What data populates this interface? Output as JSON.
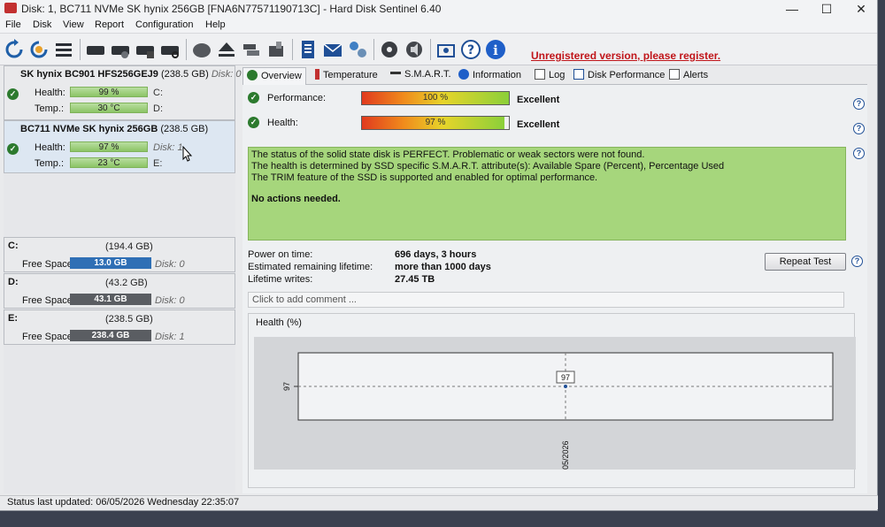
{
  "window": {
    "title": "Disk: 1, BC711 NVMe SK hynix 256GB [FNA6N77571190713C]  -  Hard Disk Sentinel 6.40",
    "controls": {
      "minimize": "—",
      "maximize": "☐",
      "close": "✕"
    }
  },
  "menu": [
    "File",
    "Disk",
    "View",
    "Report",
    "Configuration",
    "Help"
  ],
  "toolbar": {
    "unregistered_text": "Unregistered version, please register.",
    "buttons": [
      "refresh-icon",
      "refresh-all-icon",
      "list-icon",
      "disk-hdd-icon",
      "disk-test-icon",
      "disk-schedule-icon",
      "disk-search-icon",
      "disk-gray-icon",
      "eject-icon",
      "disk-stack-icon",
      "disk-copy-icon",
      "report-icon",
      "mail-icon",
      "network-icon",
      "settings-icon",
      "sound-icon",
      "camera-icon",
      "help-icon",
      "info-icon"
    ]
  },
  "left": {
    "disks": [
      {
        "name": "SK hynix BC901 HFS256GEJ9",
        "size": "(238.5 GB)",
        "disk_label": "Disk: 0",
        "health_label": "Health:",
        "health": "99 %",
        "health_value": 99,
        "temp_label": "Temp.:",
        "temp": "30 °C",
        "drive1": "C:",
        "drive2": "D:"
      },
      {
        "name": "BC711 NVMe SK hynix 256GB",
        "size": "(238.5 GB)",
        "disk_label": "Disk: 1",
        "health_label": "Health:",
        "health": "97 %",
        "health_value": 97,
        "temp_label": "Temp.:",
        "temp": "23 °C",
        "drive1": "E:"
      }
    ],
    "volumes": [
      {
        "letter": "C:",
        "size": "(194.4 GB)",
        "free_label": "Free Space",
        "free": "13.0 GB",
        "disk": "Disk: 0",
        "color": "#2f6fb5"
      },
      {
        "letter": "D:",
        "size": "(43.2 GB)",
        "free_label": "Free Space",
        "free": "43.1 GB",
        "disk": "Disk: 0",
        "color": "#5a5d62"
      },
      {
        "letter": "E:",
        "size": "(238.5 GB)",
        "free_label": "Free Space",
        "free": "238.4 GB",
        "disk": "Disk: 1",
        "color": "#5a5d62"
      }
    ]
  },
  "tabs": [
    "Overview",
    "Temperature",
    "S.M.A.R.T.",
    "Information",
    "Log",
    "Disk Performance",
    "Alerts"
  ],
  "overview": {
    "performance_label": "Performance:",
    "performance": "100 %",
    "performance_grade": "Excellent",
    "health_label": "Health:",
    "health": "97 %",
    "health_grade": "Excellent",
    "status_lines": [
      "The status of the solid state disk is PERFECT. Problematic or weak sectors were not found.",
      "The health is determined by SSD specific S.M.A.R.T. attribute(s):  Available Spare (Percent), Percentage Used",
      "The TRIM feature of the SSD is supported and enabled for optimal performance."
    ],
    "status_action": "No actions needed.",
    "power_on_label": "Power on time:",
    "power_on": "696 days, 3 hours",
    "remaining_label": "Estimated remaining lifetime:",
    "remaining": "more than 1000 days",
    "writes_label": "Lifetime writes:",
    "writes": "27.45 TB",
    "repeat_button": "Repeat Test",
    "comment_placeholder": "Click to add comment ...",
    "health_chart_title": "Health (%)"
  },
  "chart_data": {
    "type": "line",
    "title": "Health (%)",
    "x": [
      "06/05/2026"
    ],
    "series": [
      {
        "values": [
          97
        ]
      }
    ],
    "ytick": "97",
    "data_label": "97"
  },
  "status": {
    "text": "Status last updated: 06/05/2026 Wednesday 22:35:07"
  }
}
